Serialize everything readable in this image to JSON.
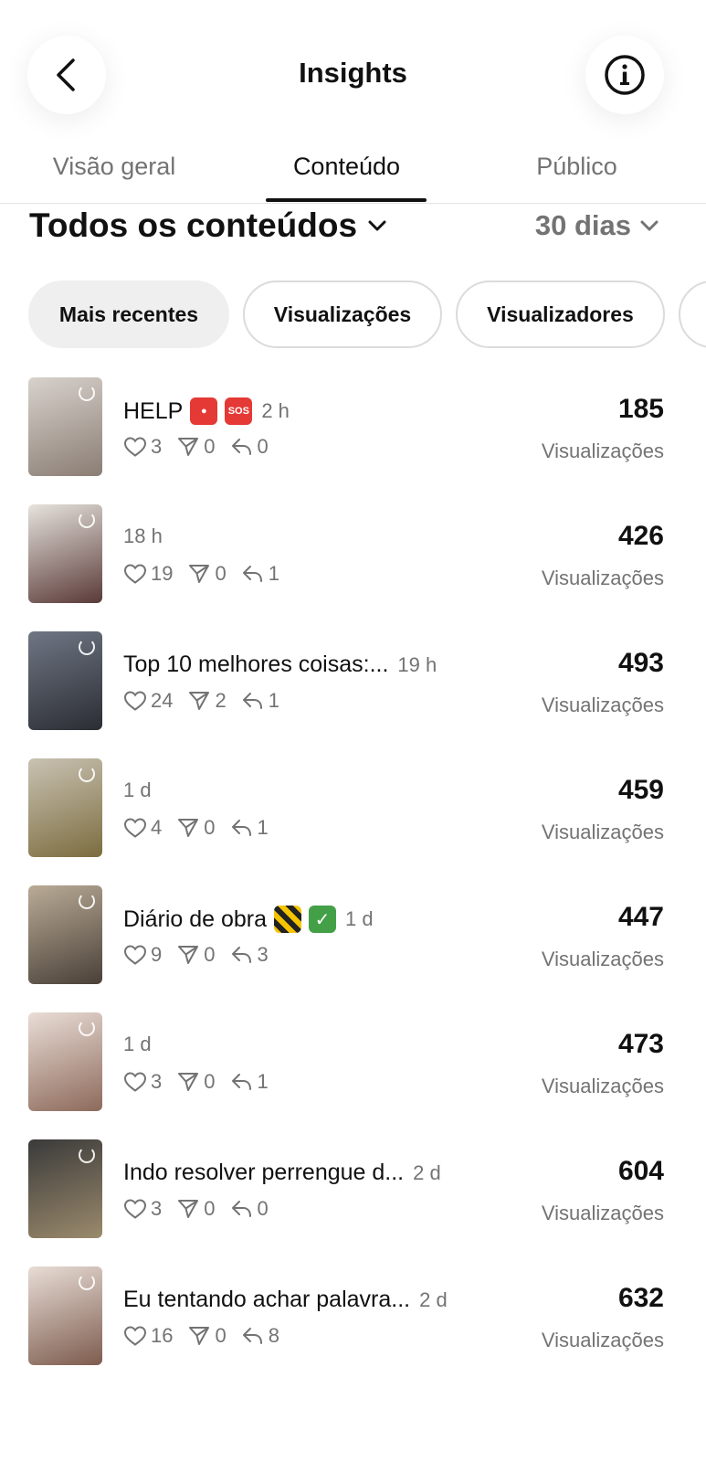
{
  "header": {
    "title": "Insights",
    "back_icon": "chevron-left-icon",
    "info_icon": "info-icon"
  },
  "tabs": [
    {
      "label": "Visão geral"
    },
    {
      "label": "Conteúdo",
      "active": true
    },
    {
      "label": "Público"
    }
  ],
  "section": {
    "title": "Todos os conteúdos",
    "range": "30 dias"
  },
  "chips": [
    {
      "label": "Mais recentes",
      "active": true
    },
    {
      "label": "Visualizações"
    },
    {
      "label": "Visualizadores"
    },
    {
      "label": ""
    }
  ],
  "items": [
    {
      "caption": "HELP",
      "emojis": [
        "siren",
        "sos"
      ],
      "age": "2 h",
      "likes": "3",
      "shares": "0",
      "replies": "0",
      "views": "185",
      "views_label": "Visualizações",
      "thumb": [
        "#d8d2cc",
        "#8a7d74"
      ]
    },
    {
      "caption": "",
      "emojis": [],
      "age": "18 h",
      "likes": "19",
      "shares": "0",
      "replies": "1",
      "views": "426",
      "views_label": "Visualizações",
      "thumb": [
        "#e6e3dd",
        "#5a3a38"
      ]
    },
    {
      "caption": "Top 10 melhores coisas:...",
      "emojis": [],
      "age": "19 h",
      "likes": "24",
      "shares": "2",
      "replies": "1",
      "views": "493",
      "views_label": "Visualizações",
      "thumb": [
        "#6f7684",
        "#2b2d33"
      ]
    },
    {
      "caption": "",
      "emojis": [],
      "age": "1 d",
      "likes": "4",
      "shares": "0",
      "replies": "1",
      "views": "459",
      "views_label": "Visualizações",
      "thumb": [
        "#c9c2b3",
        "#7c6d3f"
      ]
    },
    {
      "caption": "Diário de obra",
      "emojis": [
        "construction",
        "check"
      ],
      "age": "1 d",
      "likes": "9",
      "shares": "0",
      "replies": "3",
      "views": "447",
      "views_label": "Visualizações",
      "thumb": [
        "#b9ab96",
        "#4a4038"
      ]
    },
    {
      "caption": "",
      "emojis": [],
      "age": "1 d",
      "likes": "3",
      "shares": "0",
      "replies": "1",
      "views": "473",
      "views_label": "Visualizações",
      "thumb": [
        "#e9ddd6",
        "#8d6a5b"
      ]
    },
    {
      "caption": "Indo resolver perrengue d...",
      "emojis": [],
      "age": "2 d",
      "likes": "3",
      "shares": "0",
      "replies": "0",
      "views": "604",
      "views_label": "Visualizações",
      "thumb": [
        "#3a3a3a",
        "#9b8a6c"
      ]
    },
    {
      "caption": "Eu tentando achar palavra...",
      "emojis": [],
      "age": "2 d",
      "likes": "16",
      "shares": "0",
      "replies": "8",
      "views": "632",
      "views_label": "Visualizações",
      "thumb": [
        "#e8ddd6",
        "#7d5c4e"
      ]
    }
  ]
}
